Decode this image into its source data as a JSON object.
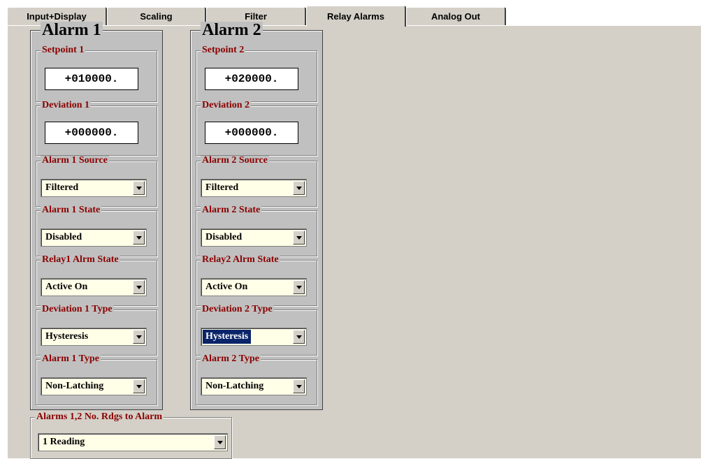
{
  "tabs": [
    {
      "label": "Input+Display"
    },
    {
      "label": "Scaling"
    },
    {
      "label": "Filter"
    },
    {
      "label": "Relay Alarms"
    },
    {
      "label": "Analog Out"
    }
  ],
  "alarm1": {
    "title": "Alarm 1",
    "setpoint_label": "Setpoint 1",
    "setpoint_value": "+010000.",
    "deviation_label": "Deviation 1",
    "deviation_value": "+000000.",
    "source_label": "Alarm 1 Source",
    "source_value": "Filtered",
    "state_label": "Alarm 1 State",
    "state_value": "Disabled",
    "relay_label": "Relay1 Alrm State",
    "relay_value": "Active On",
    "devtype_label": "Deviation 1 Type",
    "devtype_value": "Hysteresis",
    "type_label": "Alarm 1 Type",
    "type_value": "Non-Latching"
  },
  "alarm2": {
    "title": "Alarm 2",
    "setpoint_label": "Setpoint 2",
    "setpoint_value": "+020000.",
    "deviation_label": "Deviation 2",
    "deviation_value": "+000000.",
    "source_label": "Alarm 2 Source",
    "source_value": "Filtered",
    "state_label": "Alarm 2 State",
    "state_value": "Disabled",
    "relay_label": "Relay2 Alrm State",
    "relay_value": "Active On",
    "devtype_label": "Deviation 2 Type",
    "devtype_value": "Hysteresis",
    "type_label": "Alarm 2 Type",
    "type_value": "Non-Latching"
  },
  "readings": {
    "label": "Alarms 1,2  No. Rdgs to Alarm",
    "value": "1 Reading"
  },
  "colors": {
    "legend": "#8b0000",
    "combo_bg": "#ffffe8",
    "selection": "#0a246a",
    "panel": "#d4d0c8"
  }
}
